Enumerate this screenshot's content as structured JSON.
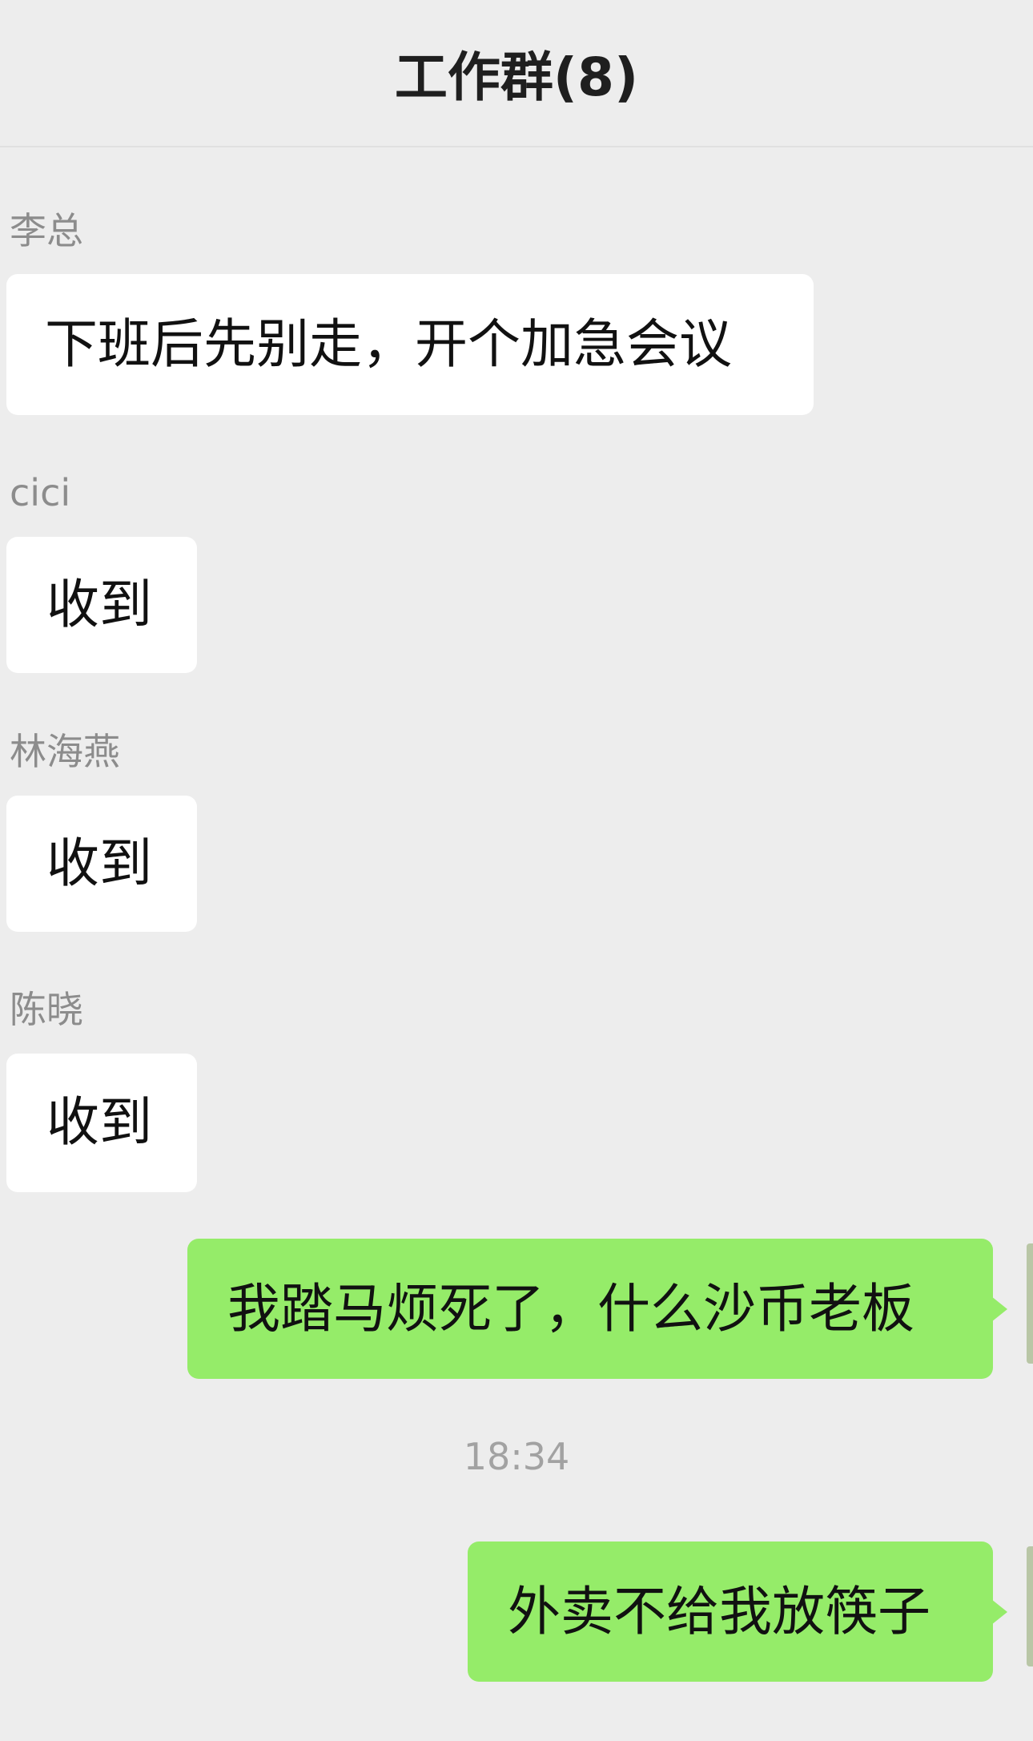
{
  "header": {
    "title": "工作群(8)"
  },
  "messages": [
    {
      "sender": "李总",
      "text": "下班后先别走，开个加急会议",
      "direction": "in"
    },
    {
      "sender": "cici",
      "text": "收到",
      "direction": "in"
    },
    {
      "sender": "林海燕",
      "text": "收到",
      "direction": "in"
    },
    {
      "sender": "陈晓",
      "text": "收到",
      "direction": "in"
    },
    {
      "text": "我踏马烦死了，什么沙币老板",
      "direction": "out"
    },
    {
      "text": "外卖不给我放筷子",
      "direction": "out"
    }
  ],
  "timestamp": "18:34",
  "colors": {
    "background": "#ededed",
    "incoming_bubble": "#ffffff",
    "outgoing_bubble": "#95ec69",
    "sender_name": "#8c8c8c",
    "title": "#1f1f1f"
  }
}
